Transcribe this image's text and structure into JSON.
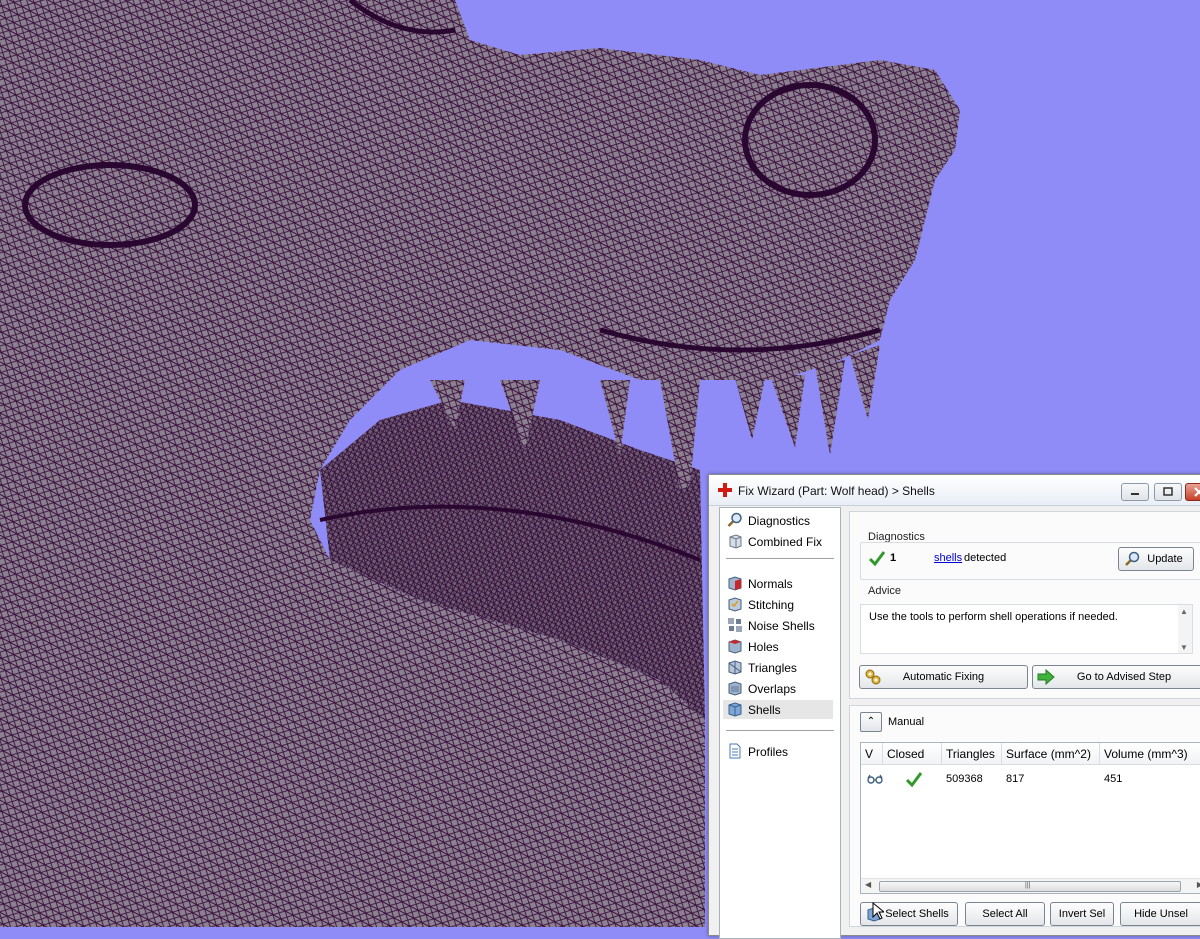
{
  "window": {
    "title": "Fix Wizard (Part: Wolf head) > Shells"
  },
  "nav": {
    "items": [
      {
        "label": "Diagnostics",
        "icon": "magnifier-icon"
      },
      {
        "label": "Combined Fix",
        "icon": "cube-stack-icon"
      },
      {
        "label": "Normals",
        "icon": "cube-red-icon"
      },
      {
        "label": "Stitching",
        "icon": "cube-stitch-icon"
      },
      {
        "label": "Noise Shells",
        "icon": "noise-shells-icon"
      },
      {
        "label": "Holes",
        "icon": "cube-hole-icon"
      },
      {
        "label": "Triangles",
        "icon": "cube-triangles-icon"
      },
      {
        "label": "Overlaps",
        "icon": "cube-overlaps-icon"
      },
      {
        "label": "Shells",
        "icon": "cube-shells-icon"
      },
      {
        "label": "Profiles",
        "icon": "document-icon"
      }
    ],
    "selected": "Shells"
  },
  "diagnostics": {
    "group_label": "Diagnostics",
    "count": "1",
    "link_text": "shells",
    "suffix_text": "detected",
    "update_label": "Update",
    "advice_label": "Advice",
    "advice_text": "Use the tools to perform shell operations if needed."
  },
  "actions": {
    "automatic_fixing": "Automatic Fixing",
    "go_to_advised": "Go to Advised Step"
  },
  "manual": {
    "label": "Manual",
    "columns": [
      "V",
      "Closed",
      "Triangles",
      "Surface (mm^2)",
      "Volume (mm^3)"
    ],
    "rows": [
      {
        "visible_icon": "glasses-icon",
        "closed": "check",
        "triangles": "509368",
        "surface": "817",
        "volume": "451"
      }
    ],
    "buttons": {
      "select_shells": "Select Shells",
      "select_all": "Select All",
      "invert_sel": "Invert Sel",
      "hide_unsel": "Hide Unsel"
    }
  },
  "colors": {
    "viewport_background": "#8f8cf7",
    "mesh_fill": "#7a6f7d",
    "mesh_lines": "#3b0f3e",
    "link": "#0000cc",
    "check_green": "#2f9a2a"
  }
}
